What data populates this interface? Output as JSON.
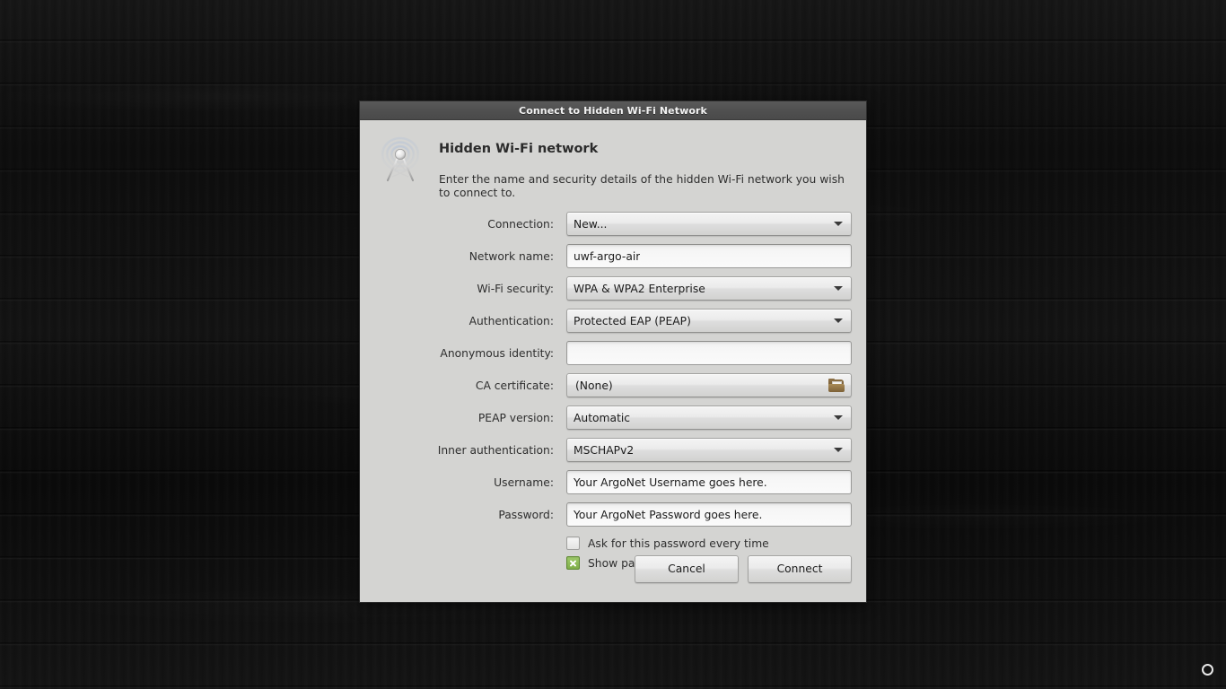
{
  "desktop": {
    "cursor_indicator": "ring-cursor"
  },
  "dialog": {
    "titlebar": {
      "title": "Connect to Hidden Wi-Fi Network"
    },
    "header": {
      "icon": "wifi-tower-icon",
      "title": "Hidden Wi-Fi network",
      "description": "Enter the name and security details of the hidden Wi-Fi network you wish to connect to."
    },
    "fields": [
      {
        "name": "connection",
        "label": "Connection:",
        "type": "combobox",
        "value": "New..."
      },
      {
        "name": "network-name",
        "label": "Network name:",
        "type": "entry",
        "value": "uwf-argo-air",
        "placeholder": ""
      },
      {
        "name": "wifi-security",
        "label": "Wi-Fi security:",
        "type": "combobox",
        "value": "WPA & WPA2 Enterprise"
      },
      {
        "name": "authentication",
        "label": "Authentication:",
        "type": "combobox",
        "value": "Protected EAP (PEAP)"
      },
      {
        "name": "anonymous-identity",
        "label": "Anonymous identity:",
        "type": "entry",
        "value": "",
        "placeholder": ""
      },
      {
        "name": "ca-certificate",
        "label": "CA certificate:",
        "type": "filechooser",
        "value": "(None)",
        "icon": "folder-icon"
      },
      {
        "name": "peap-version",
        "label": "PEAP version:",
        "type": "combobox",
        "value": "Automatic"
      },
      {
        "name": "inner-authentication",
        "label": "Inner authentication:",
        "type": "combobox",
        "value": "MSCHAPv2"
      },
      {
        "name": "username",
        "label": "Username:",
        "type": "entry",
        "value": "Your ArgoNet Username goes here.",
        "placeholder": ""
      },
      {
        "name": "password",
        "label": "Password:",
        "type": "entry",
        "value": "Your ArgoNet Password goes here.",
        "placeholder": ""
      }
    ],
    "checkboxes": [
      {
        "name": "ask-for-password-every-time",
        "label": "Ask for this password every time",
        "checked": false
      },
      {
        "name": "show-password",
        "label": "Show password",
        "checked": true
      }
    ],
    "buttons": {
      "cancel": "Cancel",
      "connect": "Connect"
    }
  },
  "colors": {
    "dialog_bg": "#d4d4d2",
    "titlebar_bg": "#4f4f4f",
    "titlebar_text": "#f2f2f2",
    "text": "#2e2e2e",
    "entry_bg": "#fafafa",
    "checkbox_checked": "#7fae48",
    "wallpaper": "#101010"
  }
}
